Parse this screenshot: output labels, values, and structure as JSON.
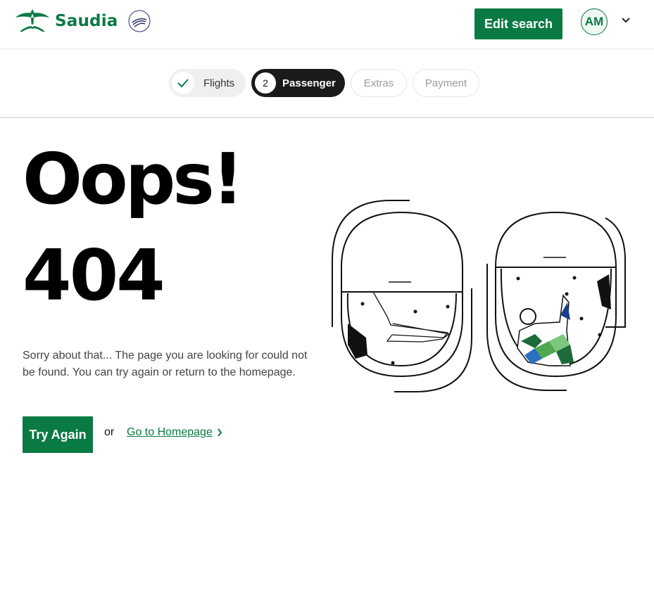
{
  "header": {
    "brand": "Saudia",
    "skyteam": "SKYTEAM",
    "edit_search_label": "Edit search",
    "avatar_initials": "AM"
  },
  "stepper": {
    "steps": [
      {
        "label": "Flights",
        "state": "done"
      },
      {
        "label": "Passenger",
        "number": "2",
        "state": "current"
      },
      {
        "label": "Extras",
        "state": "upcoming"
      },
      {
        "label": "Payment",
        "state": "upcoming"
      }
    ]
  },
  "main": {
    "headline": "Oops!",
    "error_code": "404",
    "message": "Sorry about that... The page you are looking for could not be found. You can try again or return to the homepage.",
    "try_again_label": "Try Again",
    "or_text": "or",
    "homepage_link": "Go to Homepage"
  },
  "colors": {
    "brand_green": "#0a7a43",
    "dark": "#1a1a1a"
  },
  "icons": {
    "logo": "saudia-palm-swords-icon",
    "alliance": "skyteam-logo-icon",
    "chevron": "chevron-down-icon",
    "check": "check-icon",
    "link_arrow": "chevron-right-icon"
  }
}
